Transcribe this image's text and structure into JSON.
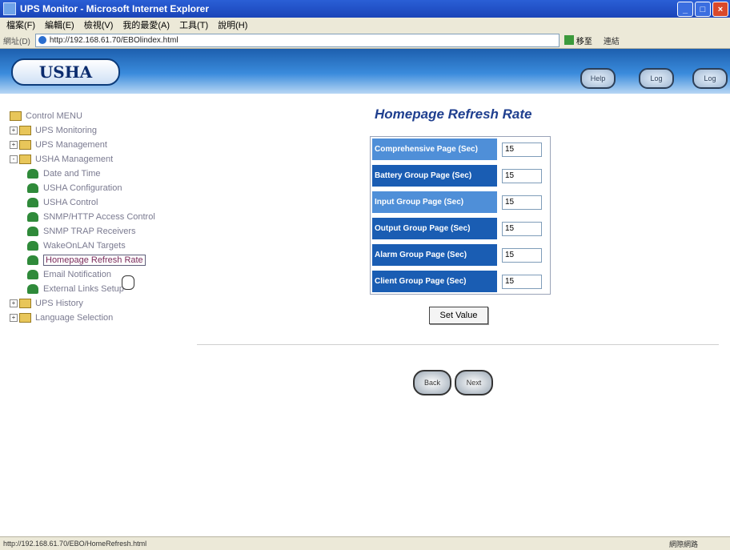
{
  "window": {
    "title": "UPS Monitor - Microsoft Internet Explorer"
  },
  "menubar": [
    "檔案(F)",
    "編輯(E)",
    "檢視(V)",
    "我的最愛(A)",
    "工具(T)",
    "說明(H)"
  ],
  "addressbar": {
    "label": "網址(D)",
    "url": "http://192.168.61.70/EBOlindex.html",
    "go_label": "移至",
    "links_label": "連結"
  },
  "header": {
    "logo": "USHA",
    "buttons": [
      "Help",
      "Log",
      "Log"
    ]
  },
  "tree": {
    "root": "Control MENU",
    "items": [
      {
        "label": "UPS Monitoring",
        "type": "folder"
      },
      {
        "label": "UPS Management",
        "type": "folder"
      },
      {
        "label": "USHA Management",
        "type": "folder"
      },
      {
        "label": "Date and Time",
        "type": "leaf"
      },
      {
        "label": "USHA Configuration",
        "type": "leaf"
      },
      {
        "label": "USHA Control",
        "type": "leaf"
      },
      {
        "label": "SNMP/HTTP Access Control",
        "type": "leaf"
      },
      {
        "label": "SNMP TRAP Receivers",
        "type": "leaf"
      },
      {
        "label": "WakeOnLAN Targets",
        "type": "leaf"
      },
      {
        "label": "Homepage Refresh Rate",
        "type": "leaf",
        "selected": true
      },
      {
        "label": "Email Notification",
        "type": "leaf"
      },
      {
        "label": "External Links Setup",
        "type": "leaf"
      },
      {
        "label": "UPS History",
        "type": "folder"
      },
      {
        "label": "Language Selection",
        "type": "folder"
      }
    ]
  },
  "main": {
    "title": "Homepage Refresh Rate",
    "fields": [
      {
        "label": "Comprehensive Page (Sec)",
        "value": "15"
      },
      {
        "label": "Battery Group Page (Sec)",
        "value": "15"
      },
      {
        "label": "Input Group Page (Sec)",
        "value": "15"
      },
      {
        "label": "Output Group Page (Sec)",
        "value": "15"
      },
      {
        "label": "Alarm Group Page (Sec)",
        "value": "15"
      },
      {
        "label": "Client Group Page (Sec)",
        "value": "15"
      }
    ],
    "set_button": "Set Value",
    "nav_buttons": [
      "Back",
      "Next"
    ]
  },
  "statusbar": {
    "url": "http://192.168.61.70/EBO/HomeRefresh.html",
    "zone": "網際網路"
  }
}
